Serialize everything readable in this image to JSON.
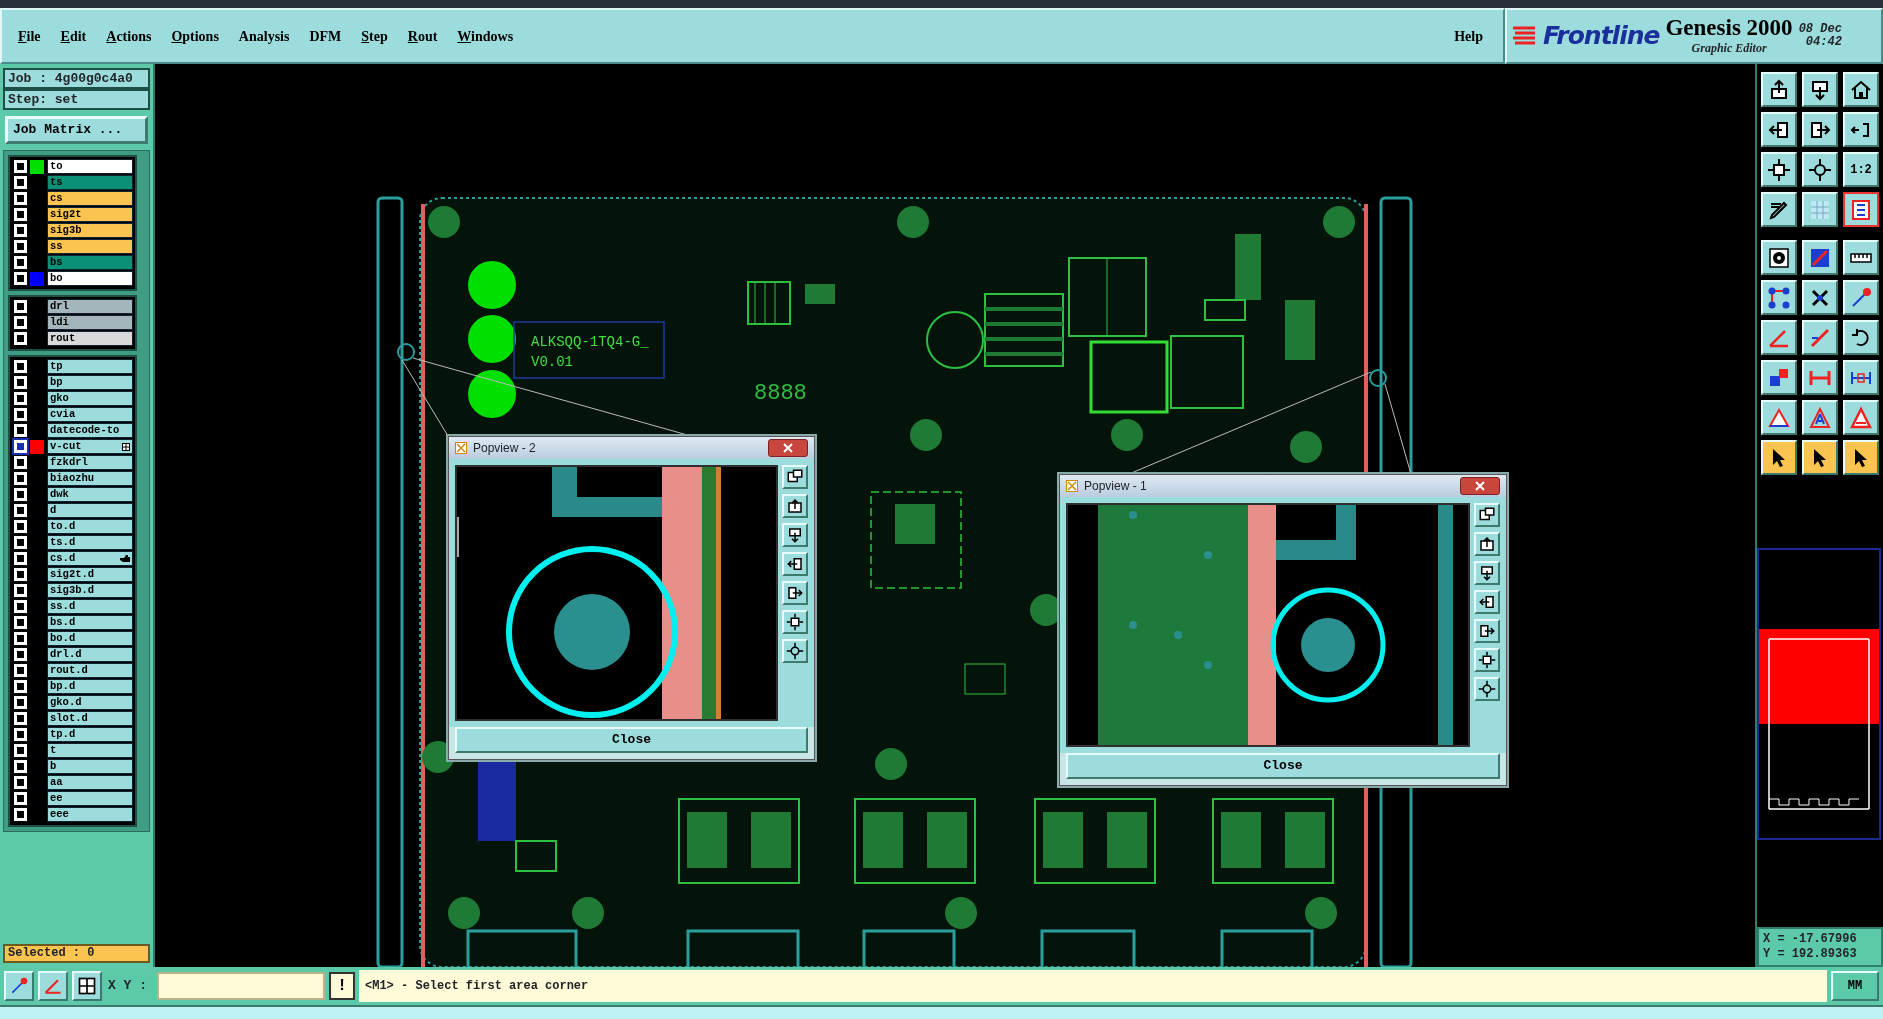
{
  "menu": {
    "items": [
      {
        "label": "File",
        "underlined": true
      },
      {
        "label": "Edit",
        "underlined": true
      },
      {
        "label": "Actions",
        "underlined": true
      },
      {
        "label": "Options",
        "underlined": true
      },
      {
        "label": "Analysis",
        "underlined": false
      },
      {
        "label": "DFM",
        "underlined": false
      },
      {
        "label": "Step",
        "underlined": true
      },
      {
        "label": "Rout",
        "underlined": true
      },
      {
        "label": "Windows",
        "underlined": true
      }
    ],
    "help": "Help"
  },
  "brand": {
    "logo": "Frontline",
    "product": "Genesis 2000",
    "subtitle": "Graphic Editor",
    "date": "08 Dec",
    "time": "04:42"
  },
  "job": {
    "job": "Job : 4g00g0c4a0",
    "step": "Step: set",
    "matrix_button": "Job Matrix ..."
  },
  "layer_groups": [
    {
      "layers": [
        {
          "name": "to",
          "kind": "silk",
          "selected": false,
          "color": "#00e000"
        },
        {
          "name": "ts",
          "kind": "mask",
          "selected": false
        },
        {
          "name": "cs",
          "kind": "signal",
          "selected": false
        },
        {
          "name": "sig2t",
          "kind": "signal",
          "selected": false
        },
        {
          "name": "sig3b",
          "kind": "signal",
          "selected": false
        },
        {
          "name": "ss",
          "kind": "signal",
          "selected": false
        },
        {
          "name": "bs",
          "kind": "mask",
          "selected": false
        },
        {
          "name": "bo",
          "kind": "silk",
          "selected": false,
          "color": "#0000ff"
        }
      ]
    },
    {
      "layers": [
        {
          "name": "drl",
          "kind": "drill",
          "selected": false
        },
        {
          "name": "ldi",
          "kind": "drill",
          "selected": false
        },
        {
          "name": "rout",
          "kind": "rout",
          "selected": false
        }
      ]
    },
    {
      "layers": [
        {
          "name": "tp",
          "kind": "document",
          "selected": false
        },
        {
          "name": "bp",
          "kind": "document",
          "selected": false
        },
        {
          "name": "gko",
          "kind": "document",
          "selected": false
        },
        {
          "name": "cvia",
          "kind": "document",
          "selected": false
        },
        {
          "name": "datecode-to",
          "kind": "document",
          "selected": false
        },
        {
          "name": "v-cut",
          "kind": "document",
          "selected": true,
          "color": "#ff0000",
          "marked": true
        },
        {
          "name": "fzkdrl",
          "kind": "document",
          "selected": false
        },
        {
          "name": "biaozhu",
          "kind": "document",
          "selected": false
        },
        {
          "name": "dwk",
          "kind": "document",
          "selected": false
        },
        {
          "name": "d",
          "kind": "document",
          "selected": false
        },
        {
          "name": "to.d",
          "kind": "document",
          "selected": false
        },
        {
          "name": "ts.d",
          "kind": "document",
          "selected": false
        },
        {
          "name": "cs.d",
          "kind": "document",
          "selected": false,
          "pointed": true
        },
        {
          "name": "sig2t.d",
          "kind": "document",
          "selected": false
        },
        {
          "name": "sig3b.d",
          "kind": "document",
          "selected": false
        },
        {
          "name": "ss.d",
          "kind": "document",
          "selected": false
        },
        {
          "name": "bs.d",
          "kind": "document",
          "selected": false
        },
        {
          "name": "bo.d",
          "kind": "document",
          "selected": false
        },
        {
          "name": "drl.d",
          "kind": "document",
          "selected": false
        },
        {
          "name": "rout.d",
          "kind": "document",
          "selected": false
        },
        {
          "name": "bp.d",
          "kind": "document",
          "selected": false
        },
        {
          "name": "gko.d",
          "kind": "document",
          "selected": false
        },
        {
          "name": "slot.d",
          "kind": "document",
          "selected": false
        },
        {
          "name": "tp.d",
          "kind": "document",
          "selected": false
        },
        {
          "name": "t",
          "kind": "document",
          "selected": false
        },
        {
          "name": "b",
          "kind": "document",
          "selected": false
        },
        {
          "name": "aa",
          "kind": "document",
          "selected": false
        },
        {
          "name": "ee",
          "kind": "document",
          "selected": false
        },
        {
          "name": "eee",
          "kind": "document",
          "selected": false
        }
      ]
    }
  ],
  "selected_count": "Selected : 0",
  "board": {
    "texts": [
      "ALKSQQ-1TQ4-G_",
      "V0.01",
      "8888"
    ]
  },
  "popviews": [
    {
      "title": "Popview - 2",
      "close": "Close",
      "kind": "left"
    },
    {
      "title": "Popview - 1",
      "close": "Close",
      "kind": "right"
    }
  ],
  "toolbar": [
    {
      "kind": "arrow-up",
      "selected": false,
      "highlighted": false
    },
    {
      "kind": "arrow-down",
      "selected": false,
      "highlighted": false
    },
    {
      "kind": "house",
      "selected": false,
      "highlighted": false
    },
    {
      "kind": "arrow-left",
      "selected": false,
      "highlighted": false
    },
    {
      "kind": "arrow-right",
      "selected": false,
      "highlighted": false
    },
    {
      "kind": "rotate",
      "selected": false,
      "highlighted": false
    },
    {
      "kind": "expand",
      "selected": false,
      "highlighted": false
    },
    {
      "kind": "move",
      "selected": false,
      "highlighted": false
    },
    {
      "kind": "text",
      "label": "1:2",
      "selected": false,
      "highlighted": false
    },
    {
      "kind": "pencil",
      "selected": false,
      "highlighted": false
    },
    {
      "kind": "grid",
      "selected": false,
      "highlighted": false
    },
    {
      "kind": "layers",
      "selected": false,
      "highlighted": true
    },
    {
      "kind": "circle",
      "selected": false,
      "highlighted": false
    },
    {
      "kind": "diagonal",
      "selected": false,
      "highlighted": false
    },
    {
      "kind": "ruler",
      "selected": false,
      "highlighted": false
    },
    {
      "kind": "nodes",
      "selected": false,
      "highlighted": false
    },
    {
      "kind": "cross",
      "selected": false,
      "highlighted": false
    },
    {
      "kind": "dot-line",
      "selected": false,
      "highlighted": false
    },
    {
      "kind": "angle",
      "selected": false,
      "highlighted": false
    },
    {
      "kind": "slash",
      "selected": false,
      "highlighted": false
    },
    {
      "kind": "curve",
      "selected": false,
      "highlighted": false
    },
    {
      "kind": "squares",
      "selected": false,
      "highlighted": false
    },
    {
      "kind": "dash",
      "selected": false,
      "highlighted": false
    },
    {
      "kind": "bracket",
      "selected": false,
      "highlighted": false
    },
    {
      "kind": "triangle",
      "selected": false,
      "highlighted": false
    },
    {
      "kind": "triangle-a",
      "selected": false,
      "highlighted": false
    },
    {
      "kind": "triangle-red",
      "selected": false,
      "highlighted": false
    },
    {
      "kind": "pointer",
      "selected": true,
      "highlighted": false
    },
    {
      "kind": "pointer",
      "selected": true,
      "highlighted": false
    },
    {
      "kind": "pointer",
      "selected": true,
      "highlighted": false
    }
  ],
  "coordinates": {
    "x": "X = -17.67996",
    "y": "Y = 192.89363"
  },
  "command_bar": {
    "xy_label": "X Y :",
    "alert": "!",
    "message": "<M1> - Select first area corner",
    "units": "MM"
  }
}
